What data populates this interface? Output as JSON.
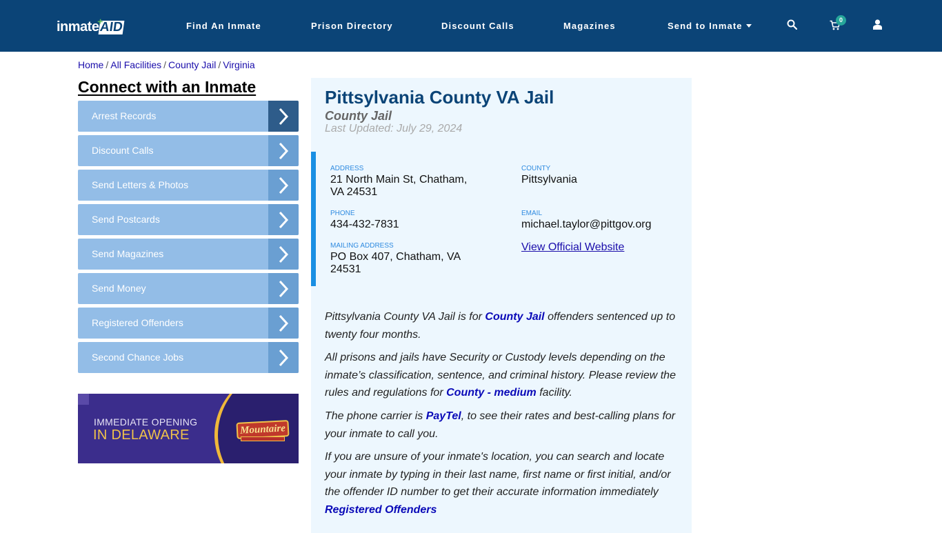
{
  "header": {
    "logo": {
      "part1": "inmate",
      "part2": "AID"
    },
    "nav": [
      {
        "label": "Find An Inmate"
      },
      {
        "label": "Prison Directory"
      },
      {
        "label": "Discount Calls"
      },
      {
        "label": "Magazines"
      },
      {
        "label": "Send to Inmate",
        "has_dropdown": true
      }
    ],
    "icons": [
      "search-icon",
      "cart-icon",
      "user-icon"
    ],
    "cart_count": "0",
    "colors": {
      "bar": "#0b4477",
      "badge": "#26a69a"
    }
  },
  "breadcrumb": [
    {
      "label": "Home"
    },
    {
      "label": "All Facilities"
    },
    {
      "label": "County Jail"
    },
    {
      "label": "Virginia"
    }
  ],
  "sidebar": {
    "title": "Connect with an Inmate",
    "items": [
      {
        "label": "Arrest Records",
        "active": true
      },
      {
        "label": "Discount Calls"
      },
      {
        "label": "Send Letters & Photos"
      },
      {
        "label": "Send Postcards"
      },
      {
        "label": "Send Magazines"
      },
      {
        "label": "Send Money"
      },
      {
        "label": "Registered Offenders"
      },
      {
        "label": "Second Chance Jobs"
      }
    ],
    "ad": {
      "line1": "IMMEDIATE OPENING",
      "line2": "IN DELAWARE",
      "brand": "Mountaire"
    }
  },
  "facility": {
    "name": "Pittsylvania County VA Jail",
    "type": "County Jail",
    "last_updated": "Last Updated: July 29, 2024",
    "address_label": "ADDRESS",
    "address": "21 North Main St, Chatham, VA 24531",
    "county_label": "COUNTY",
    "county": "Pittsylvania",
    "phone_label": "PHONE",
    "phone": "434-432-7831",
    "email_label": "EMAIL",
    "email": "michael.taylor@pittgov.org",
    "mailing_label": "MAILING ADDRESS",
    "mailing": "PO Box 407, Chatham, VA 24531",
    "website_link": "View Official Website"
  },
  "description": {
    "p1": {
      "a": "Pittsylvania County VA Jail is for ",
      "link": "County Jail",
      "b": " offenders sentenced up to twenty four months."
    },
    "p2": {
      "a": "All prisons and jails have Security or Custody levels depending on the inmate’s classification, sentence, and criminal history. Please review the rules and regulations for ",
      "link": "County - medium",
      "b": " facility."
    },
    "p3": {
      "a": "The phone carrier is ",
      "link": "PayTel",
      "b": ", to see their rates and best-calling plans for your inmate to call you."
    },
    "p4": {
      "a": "If you are unsure of your inmate's location, you can search and locate your inmate by typing in their last name, first name or first initial, and/or the offender ID number to get their accurate information immediately",
      "link": "Registered Offenders"
    }
  }
}
